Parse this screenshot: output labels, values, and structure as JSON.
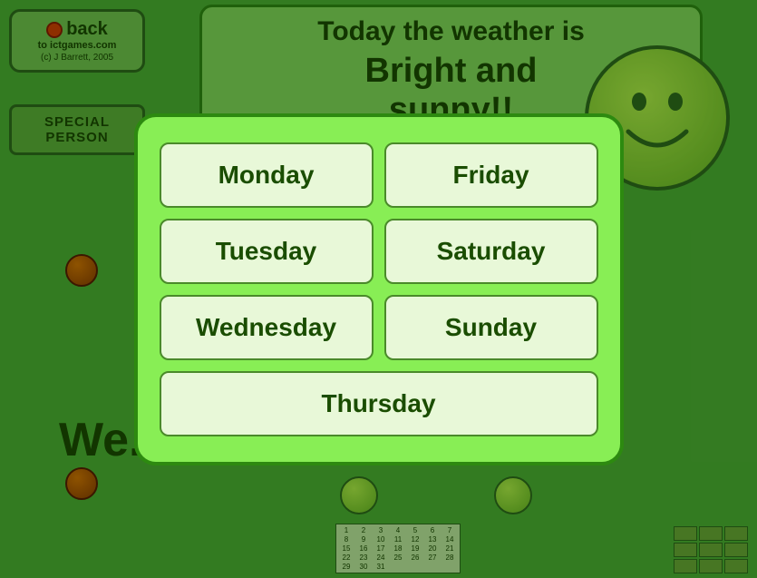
{
  "back_button": {
    "label": "back",
    "subtext": "to ictgames.com",
    "copyright": "(c) J Barrett, 2005"
  },
  "special_person": {
    "label": "SPECIAL PERSON"
  },
  "weather": {
    "header": "Today the weather is",
    "description_line1": "Bright and",
    "description_line2": "sunny!!"
  },
  "wednesday_text": "We...",
  "modal": {
    "days": [
      {
        "id": "monday",
        "label": "Monday"
      },
      {
        "id": "friday",
        "label": "Friday"
      },
      {
        "id": "tuesday",
        "label": "Tuesday"
      },
      {
        "id": "saturday",
        "label": "Saturday"
      },
      {
        "id": "wednesday",
        "label": "Wednesday"
      },
      {
        "id": "sunday",
        "label": "Sunday"
      },
      {
        "id": "thursday",
        "label": "Thursday"
      }
    ]
  },
  "calendar": {
    "numbers": [
      1,
      2,
      3,
      4,
      5,
      6,
      7,
      8,
      9,
      10,
      11,
      12,
      13,
      14,
      15,
      16,
      17,
      18,
      19,
      20,
      21,
      22,
      23,
      24,
      25,
      26,
      27,
      28,
      29,
      30,
      31
    ]
  }
}
